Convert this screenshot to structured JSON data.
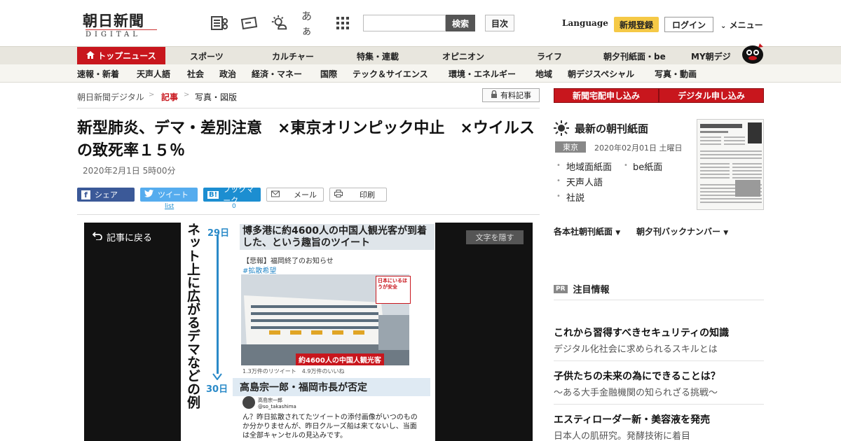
{
  "header": {
    "logo_jp": "朝日新聞",
    "logo_en": "DIGITAL",
    "search_placeholder": "",
    "search_button": "検索",
    "toc_button": "目次",
    "language": "Language",
    "signup": "新規登録",
    "login": "ログイン",
    "menu": "メニュー",
    "font_size_glyph": "あぁ"
  },
  "nav_main": {
    "active": "トップニュース",
    "items": [
      "スポーツ",
      "カルチャー",
      "特集・連載",
      "オピニオン",
      "ライフ",
      "朝夕刊紙面・be",
      "MY朝デジ"
    ]
  },
  "nav_sub": [
    "速報・新着",
    "天声人語",
    "社会",
    "政治",
    "経済・マネー",
    "国際",
    "テック＆サイエンス",
    "環境・エネルギー",
    "地域",
    "朝デジスペシャル",
    "写真・動画"
  ],
  "breadcrumb": [
    "朝日新聞デジタル",
    "記事",
    "写真・図版"
  ],
  "paid_label": "有料記事",
  "article": {
    "title": "新型肺炎、デマ・差別注意　×東京オリンピック中止　×ウイルスの致死率１５％",
    "date": "2020年2月1日 5時00分"
  },
  "share": {
    "facebook": "シェア",
    "twitter": "ツイート",
    "twitter_count": "list",
    "hatena": "ブックマーク",
    "hatena_count": "0",
    "mail": "メール",
    "print": "印刷"
  },
  "viewer": {
    "back": "記事に戻る",
    "hide_text": "文字を隠す",
    "vertical_caption": "ネット上に広がるデマなどの例",
    "day1": "29日",
    "day2": "30日",
    "caption1": "博多港に約4600人の中国人観光客が到着した、という趣旨のツイート",
    "tweet_header": "【悲報】福岡終了のお知らせ",
    "tweet_hashtag": "#拡散希望",
    "ship_banner": "約4600人の中国人観光客",
    "ship_sign": "日本にいるほうが安全",
    "tweet_stats": "1.3万件のリツイート　4.9万件のいいね",
    "caption2": "高島宗一郎・福岡市長が否定",
    "tw_name": "高島宗一郎",
    "tw_handle": "@so_takashima",
    "tw_body": "ん？昨日拡散されてたツイートの添付画像がいつのものか分かりませんが、昨日クルーズ船は来てないし、当面は全部キャンセルの見込みです。"
  },
  "sidebar": {
    "btn_paper": "新聞宅配申し込み",
    "btn_digital": "デジタル申し込み",
    "latest_head": "最新の朝刊紙面",
    "edition": "東京",
    "edition_date": "2020年02月01日 土曜日",
    "links": [
      "地域面紙面",
      "be紙面",
      "天声人語",
      "社説"
    ],
    "drop1": "各本社朝刊紙面",
    "drop2": "朝夕刊バックナンバー",
    "pr_badge": "PR",
    "pr_head": "注目情報",
    "ads": [
      {
        "title": "これから習得すべきセキュリティの知識",
        "sub": "デジタル化社会に求められるスキルとは"
      },
      {
        "title": "子供たちの未来の為にできることは？",
        "sub": "～ある大手金融機関の知られざる挑戦～"
      },
      {
        "title": "エスティローダー新・美容液を発売",
        "sub": "日本人の肌研究。発酵技術に着目"
      }
    ]
  },
  "colors": {
    "brand_red": "#c8161d",
    "signup_yellow": "#f5c946",
    "facebook": "#3b5998",
    "twitter": "#55acee",
    "hatena": "#1c8ed1"
  }
}
